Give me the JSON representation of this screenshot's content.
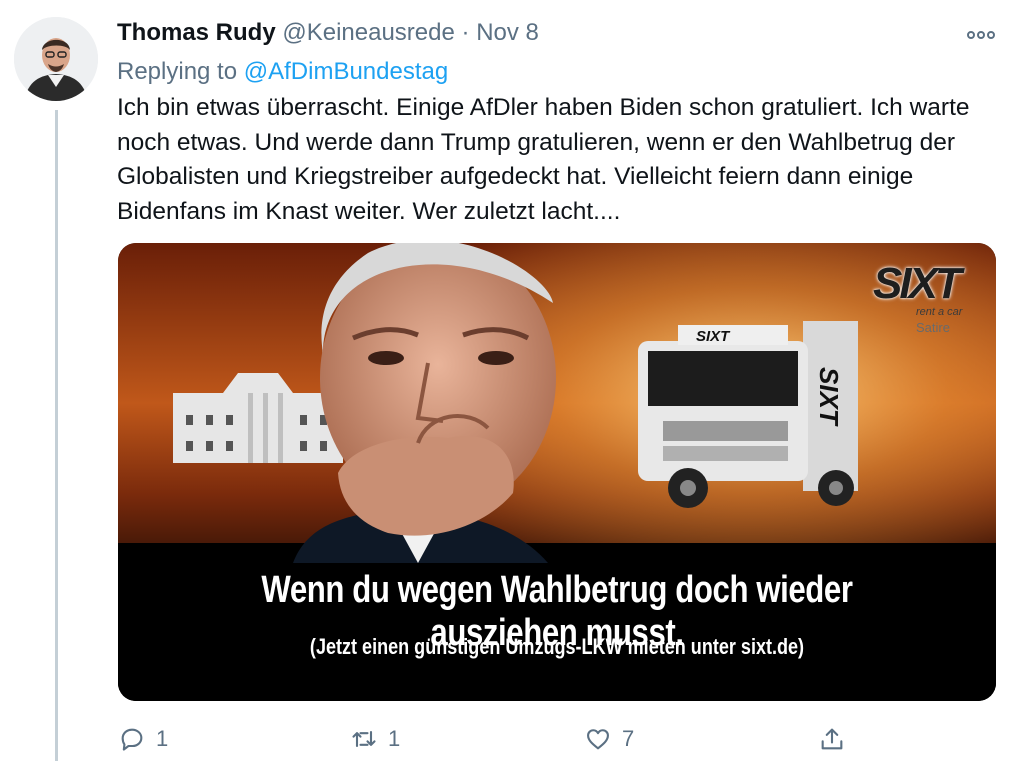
{
  "tweet": {
    "author_name": "Thomas Rudy",
    "handle": "@Keineausrede",
    "separator": "·",
    "date": "Nov 8",
    "more_icon": "more-horizontal-icon",
    "replying_prefix": "Replying to",
    "replying_to": "@AfDimBundestag",
    "text": "Ich bin etwas überrascht. Einige AfDler haben Biden schon gratuliert. Ich warte noch etwas. Und werde dann Trump gratulieren, wenn er den Wahlbetrug der Globalisten und Kriegstreiber aufgedeckt hat. Vielleicht feiern dann einige Bidenfans im Knast weiter. Wer zuletzt lacht...."
  },
  "media": {
    "caption_main": "Wenn du wegen Wahlbetrug doch wieder ausziehen musst.",
    "caption_sub": "(Jetzt einen günstigen Umzugs-LKW mieten unter sixt.de)",
    "logo_text": "SIXT",
    "logo_subtext": "rent a car",
    "logo_satire": "Satire",
    "truck_text": "SIXT"
  },
  "actions": {
    "reply_count": "1",
    "retweet_count": "1",
    "like_count": "7"
  },
  "colors": {
    "accent": "#1da1f2",
    "muted": "#5b7083",
    "text": "#0f1419"
  }
}
